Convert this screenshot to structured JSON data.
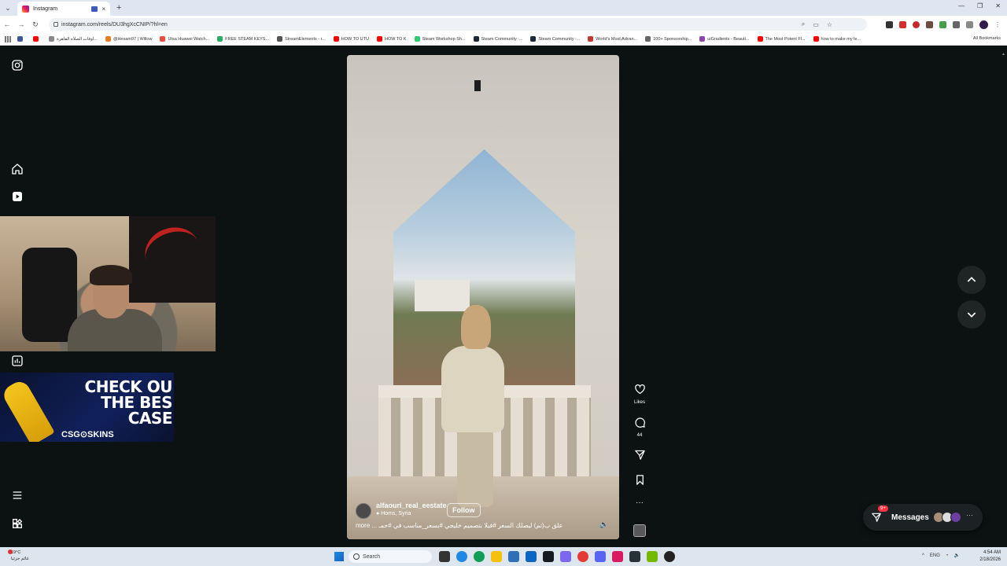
{
  "browser": {
    "tab_title": "Instagram",
    "tab_close": "×",
    "new_tab": "+",
    "url": "instagram.com/reels/DU3hgXcCNIP/?hl=en",
    "bookmarks": [
      {
        "label": "",
        "color": "#3b5998"
      },
      {
        "label": "",
        "color": "#ff0000"
      },
      {
        "label": "اوقات الصلاة القاهرة...",
        "color": "#888888"
      },
      {
        "label": "@Hesam97 | Willow",
        "color": "#e67e22"
      },
      {
        "label": "Utsa Huawei Watch...",
        "color": "#e74c3c"
      },
      {
        "label": "FREE STEAM KEYS...",
        "color": "#27ae60"
      },
      {
        "label": "StreamElements - r...",
        "color": "#555555"
      },
      {
        "label": "HOW TO UTU",
        "color": "#ff0000"
      },
      {
        "label": "HOW TO K",
        "color": "#ff0000"
      },
      {
        "label": "Steam Workshop Sh...",
        "color": "#2ecc71"
      },
      {
        "label": "Steam Community :...",
        "color": "#1b2838"
      },
      {
        "label": "Steam Community :...",
        "color": "#1b2838"
      },
      {
        "label": "World's Most Advan...",
        "color": "#c0392b"
      },
      {
        "label": "100+ Sponsorship...",
        "color": "#666666"
      },
      {
        "label": "uiGradients - Beauti...",
        "color": "#8e44ad"
      },
      {
        "label": "The Most Potent Fl...",
        "color": "#ff0000"
      },
      {
        "label": "how to make my le...",
        "color": "#ff0000"
      }
    ],
    "all_bookmarks": "All Bookmarks"
  },
  "overlay": {
    "ad_line1": "CHECK OU",
    "ad_line2": "THE BES",
    "ad_line3": "CASE",
    "ad_brand": "CSG⊙SKINS"
  },
  "reel": {
    "username": "alfaouri_real_eestate",
    "location": "Homs, Syria",
    "follow_label": "Follow",
    "caption": "علق ب(تم) ليصلك السعر #فيلا بتصميم خليجي #بسعر_مناسب في #حمـ ... more",
    "likes_label": "Likes",
    "comments_count": "44",
    "more_label": "···"
  },
  "messages": {
    "label": "Messages",
    "badge": "9+",
    "more": "···"
  },
  "taskbar": {
    "weather_temp": "19°C",
    "weather_desc": "غائم جزئيا",
    "search_label": "Search",
    "lang": "ENG",
    "time": "4:54 AM",
    "date": "2/18/2026"
  }
}
